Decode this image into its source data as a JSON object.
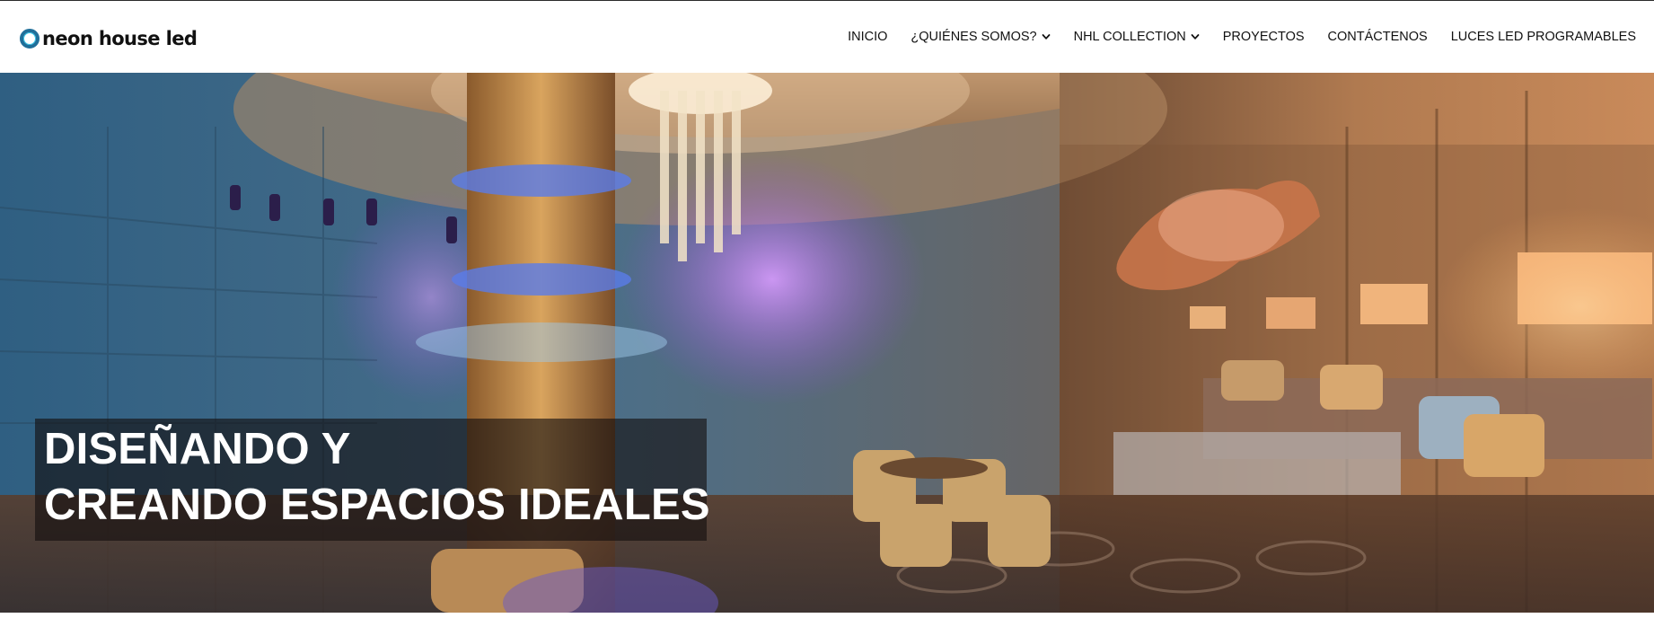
{
  "brand": {
    "name": "neon house led",
    "colors": {
      "ring": "#1f6f9a",
      "ring_glow": "#2ec4e8"
    }
  },
  "nav": {
    "items": [
      {
        "label": "INICIO",
        "has_dropdown": false
      },
      {
        "label": "¿QUIÉNES SOMOS?",
        "has_dropdown": true
      },
      {
        "label": "NHL COLLECTION",
        "has_dropdown": true
      },
      {
        "label": "PROYECTOS",
        "has_dropdown": false
      },
      {
        "label": "CONTÁCTENOS",
        "has_dropdown": false
      },
      {
        "label": "LUCES LED PROGRAMABLES",
        "has_dropdown": false
      }
    ]
  },
  "hero": {
    "title_line_1": "DISEÑANDO Y",
    "title_line_2": "CREANDO ESPACIOS IDEALES",
    "image_desc_icon": "lounge-interior-photo"
  },
  "colors": {
    "header_bg": "#ffffff",
    "text": "#111111",
    "hero_overlay": "#140e0e"
  }
}
